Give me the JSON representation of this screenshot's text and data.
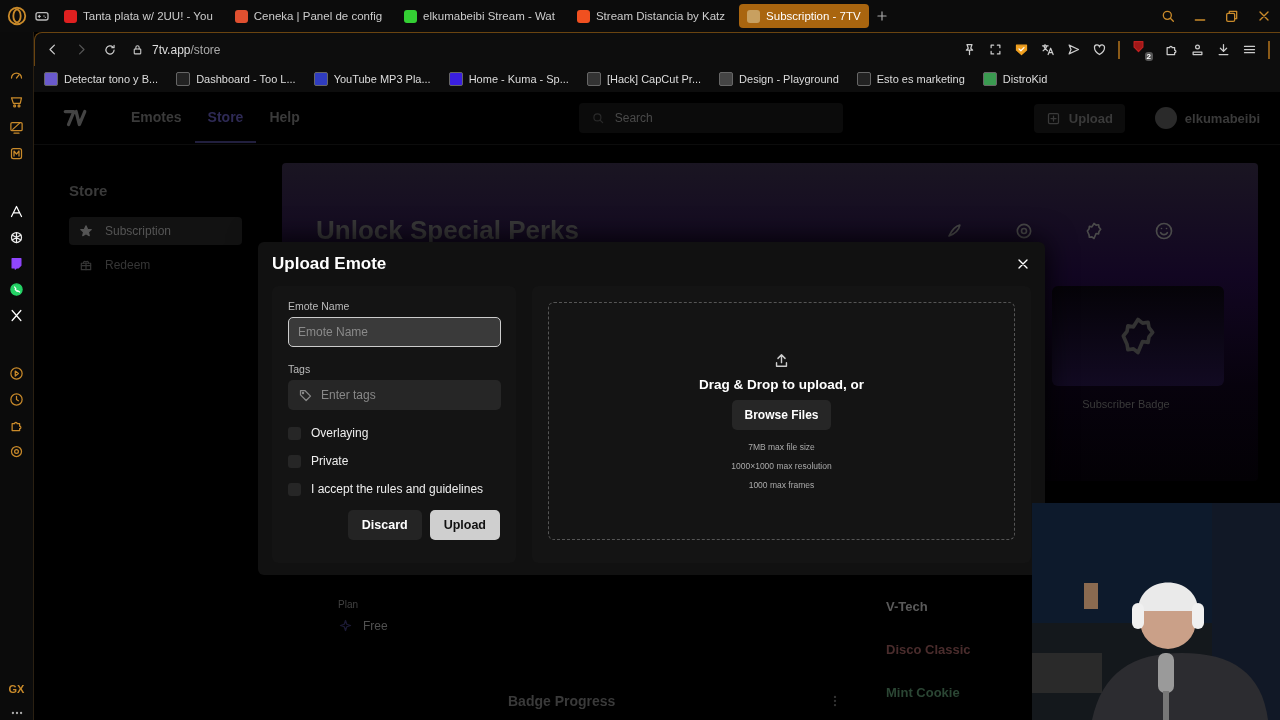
{
  "browser": {
    "tabs": [
      {
        "title": "Tanta plata w/ 2UU! - You",
        "selected": false
      },
      {
        "title": "Ceneka | Panel de config",
        "selected": false
      },
      {
        "title": "elkumabeibi Stream - Wat",
        "selected": false
      },
      {
        "title": "Stream Distancia by Katz",
        "selected": false
      },
      {
        "title": "Subscription - 7TV",
        "selected": true
      }
    ],
    "address": {
      "host": "7tv.app",
      "path": "/store"
    },
    "bookmarks": [
      "Detectar tono y B...",
      "Dashboard - Too L...",
      "YouTube MP3 Pla...",
      "Home - Kuma - Sp...",
      "[Hack] CapCut Pr...",
      "Design - Playground",
      "Esto es marketing",
      "DistroKid"
    ],
    "extension_badge": "2",
    "sidebar_label": "GX"
  },
  "site": {
    "nav": [
      {
        "label": "Emotes",
        "selected": false
      },
      {
        "label": "Store",
        "selected": true
      },
      {
        "label": "Help",
        "selected": false
      }
    ],
    "search": {
      "placeholder": "Search"
    },
    "upload_button": "Upload",
    "username": "elkumabeibi",
    "store_heading": "Store",
    "store_menu": [
      {
        "label": "Subscription",
        "selected": true
      },
      {
        "label": "Redeem",
        "selected": false
      }
    ],
    "banner_title": "Unlock Special Perks",
    "badge_card_label": "Subscriber Badge",
    "plan": {
      "label": "Plan",
      "value": "Free"
    },
    "badge_progress": "Badge Progress",
    "paints": [
      {
        "name": "V-Tech",
        "color": "#5c5c5c"
      },
      {
        "name": "Disco Classic",
        "color": "#4a2c2c"
      },
      {
        "name": "Mint Cookie",
        "color": "#2b4634"
      }
    ]
  },
  "dialog": {
    "title": "Upload Emote",
    "name_field": {
      "label": "Emote Name",
      "placeholder": "Emote Name"
    },
    "tags_field": {
      "label": "Tags",
      "placeholder": "Enter tags"
    },
    "options": [
      {
        "label": "Overlaying",
        "checked": false
      },
      {
        "label": "Private",
        "checked": false
      },
      {
        "label": "I accept the rules and guidelines",
        "checked": false
      }
    ],
    "buttons": [
      {
        "label": "Discard",
        "kind": "secondary"
      },
      {
        "label": "Upload",
        "kind": "primary"
      }
    ],
    "dropzone": {
      "prompt": "Drag & Drop to upload, or",
      "browse_button": "Browse Files",
      "limits": [
        "7MB max file size",
        "1000×1000 max resolution",
        "1000 max frames"
      ]
    }
  }
}
